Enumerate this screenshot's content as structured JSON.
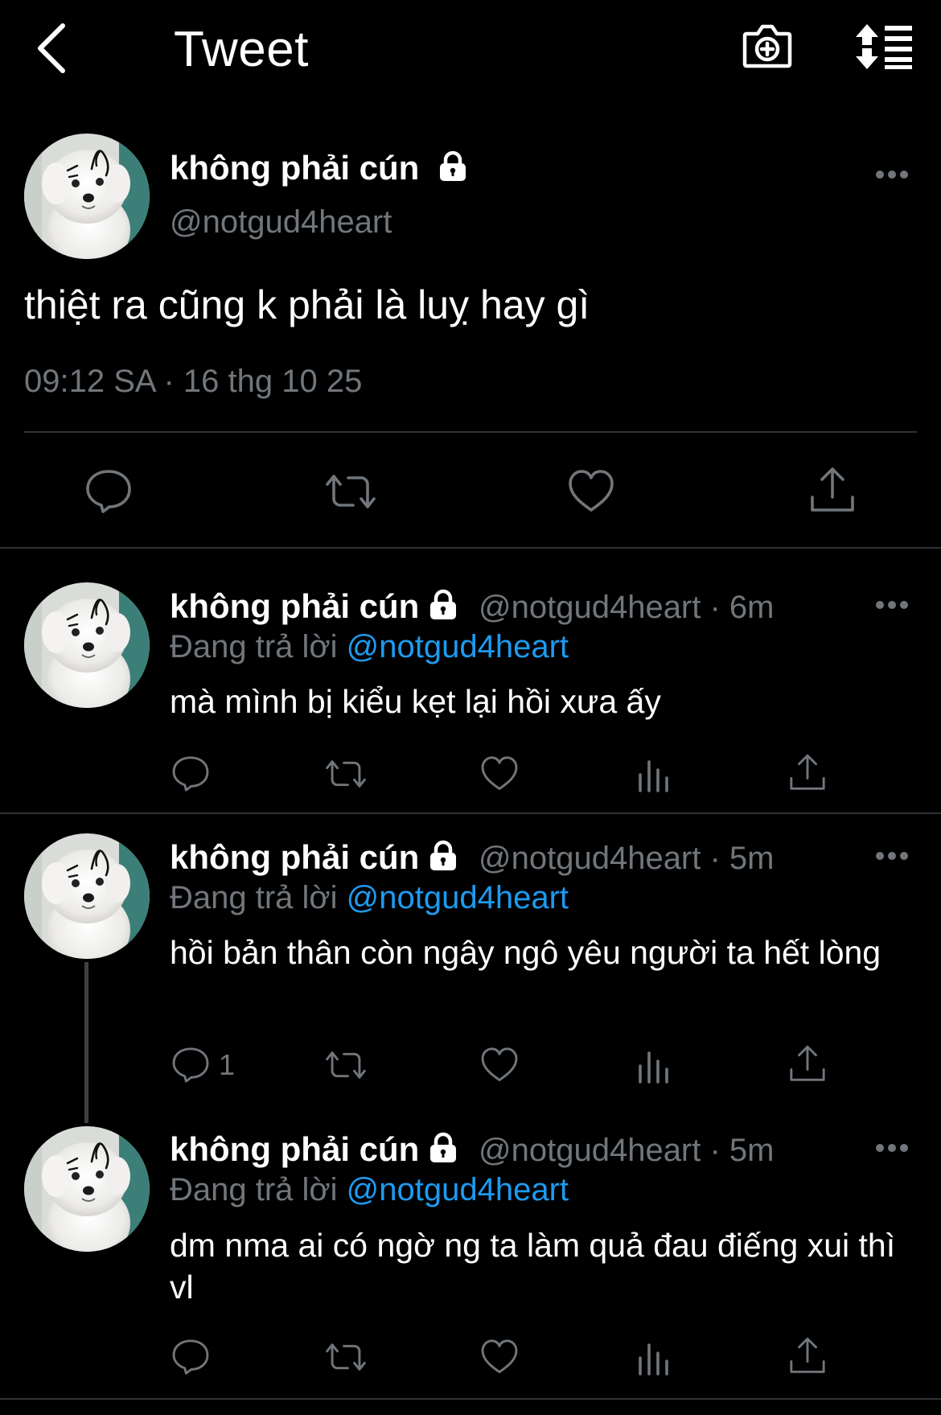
{
  "header": {
    "title": "Tweet",
    "back_icon": "chevron-left-icon",
    "camera_icon": "camera-plus-icon",
    "sort_icon": "sort-list-icon"
  },
  "main_tweet": {
    "display_name": "không phải cún",
    "handle": "@notgud4heart",
    "text": "thiệt ra cũng k phải là luỵ hay gì",
    "timestamp": "09:12 SA · 16 thg 10 25"
  },
  "replies": [
    {
      "display_name": "không phải cún",
      "handle_time": "@notgud4heart · 6m",
      "replying_prefix": "Đang trả lời",
      "replying_to": "@notgud4heart",
      "text": "mà mình bị kiểu kẹt lại hồi xưa ấy",
      "reply_count": ""
    },
    {
      "display_name": "không phải cún",
      "handle_time": "@notgud4heart · 5m",
      "replying_prefix": "Đang trả lời",
      "replying_to": "@notgud4heart",
      "text": "hồi bản thân còn ngây ngô yêu người ta hết lòng",
      "reply_count": "1"
    },
    {
      "display_name": "không phải cún",
      "handle_time": "@notgud4heart · 5m",
      "replying_prefix": "Đang trả lời",
      "replying_to": "@notgud4heart",
      "text": "dm nma ai có ngờ ng ta làm quả đau điếng xui thì vl",
      "reply_count": ""
    }
  ],
  "colors": {
    "background": "#000000",
    "text": "#ffffff",
    "muted": "#71767b",
    "link": "#1d9bf0",
    "divider": "#2f3336"
  }
}
